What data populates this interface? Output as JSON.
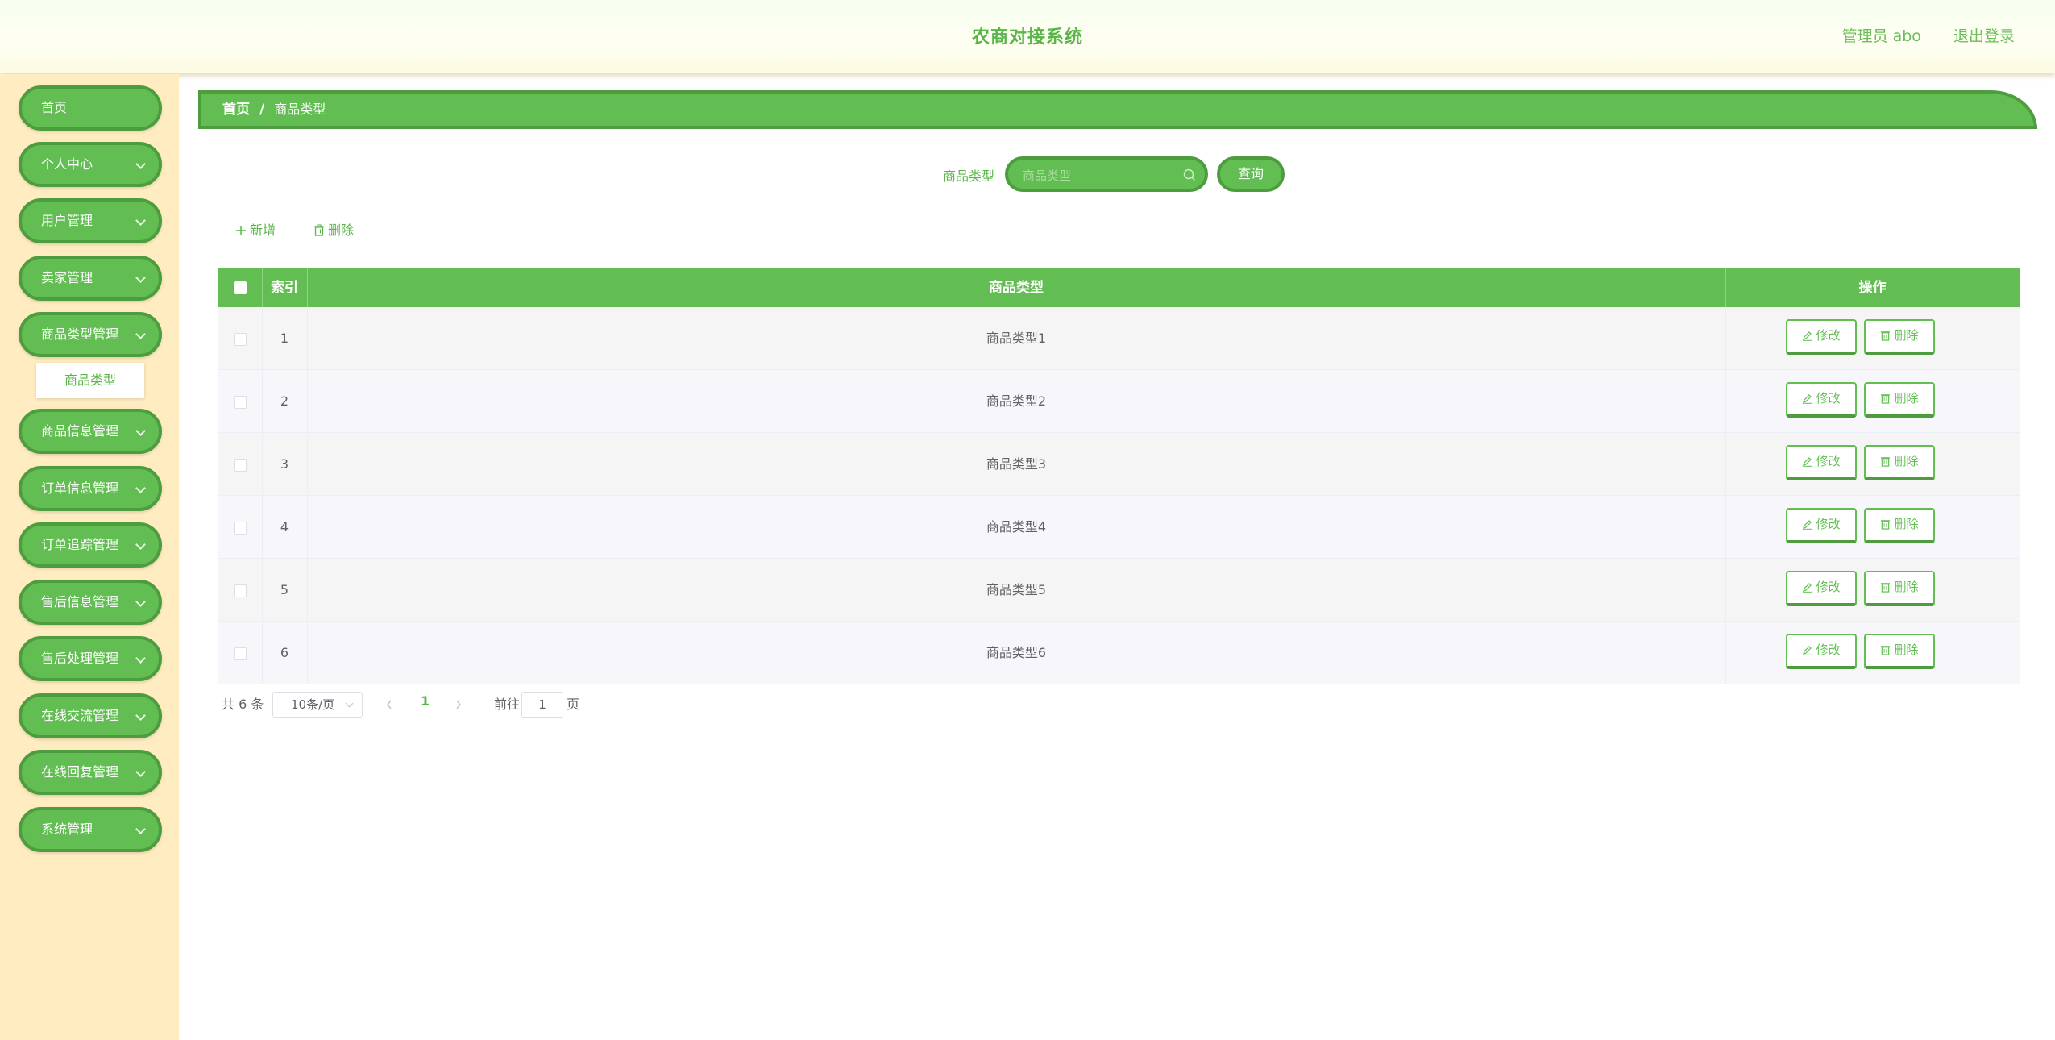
{
  "header": {
    "title": "农商对接系统",
    "user_info": "管理员 abo",
    "logout_label": "退出登录"
  },
  "sidebar": {
    "items": [
      {
        "label": "首页",
        "expandable": false
      },
      {
        "label": "个人中心",
        "expandable": true
      },
      {
        "label": "用户管理",
        "expandable": true
      },
      {
        "label": "卖家管理",
        "expandable": true
      },
      {
        "label": "商品类型管理",
        "expandable": true
      },
      {
        "label": "商品信息管理",
        "expandable": true
      },
      {
        "label": "订单信息管理",
        "expandable": true
      },
      {
        "label": "订单追踪管理",
        "expandable": true
      },
      {
        "label": "售后信息管理",
        "expandable": true
      },
      {
        "label": "售后处理管理",
        "expandable": true
      },
      {
        "label": "在线交流管理",
        "expandable": true
      },
      {
        "label": "在线回复管理",
        "expandable": true
      },
      {
        "label": "系统管理",
        "expandable": true
      }
    ],
    "open_submenu": {
      "parent": "商品类型管理",
      "item": "商品类型"
    }
  },
  "breadcrumb": {
    "home": "首页",
    "separator": "/",
    "current": "商品类型"
  },
  "search": {
    "label": "商品类型",
    "placeholder": "商品类型",
    "query_label": "查询"
  },
  "toolbar": {
    "add_label": "新增",
    "delete_label": "删除"
  },
  "table": {
    "columns": [
      "",
      "索引",
      "商品类型",
      "操作"
    ],
    "rows": [
      {
        "index": "1",
        "type": "商品类型1"
      },
      {
        "index": "2",
        "type": "商品类型2"
      },
      {
        "index": "3",
        "type": "商品类型3"
      },
      {
        "index": "4",
        "type": "商品类型4"
      },
      {
        "index": "5",
        "type": "商品类型5"
      },
      {
        "index": "6",
        "type": "商品类型6"
      }
    ],
    "edit_label": "修改",
    "delete_label": "删除"
  },
  "pagination": {
    "total_text": "共 6 条",
    "page_size": "10条/页",
    "current_page": "1",
    "goto_prefix": "前往",
    "goto_value": "1",
    "goto_suffix": "页"
  },
  "colors": {
    "primary": "#62bd52",
    "primary_dark": "#4d9d3f",
    "sidebar_bg": "#ffecc0",
    "header_bg": "#fffff2"
  }
}
